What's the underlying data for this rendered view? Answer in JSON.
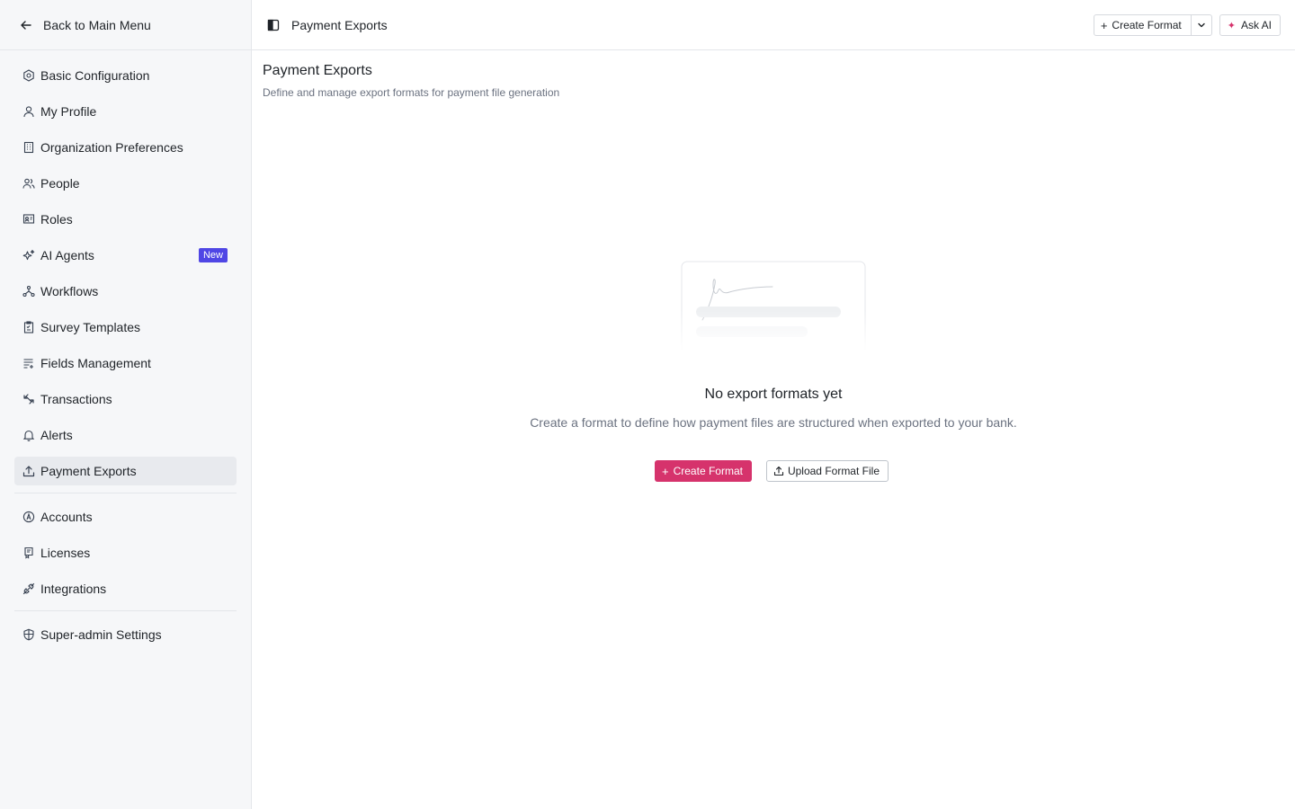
{
  "sidebar": {
    "back_label": "Back to Main Menu",
    "items": [
      {
        "label": "Basic Configuration",
        "icon": "gear-icon"
      },
      {
        "label": "My Profile",
        "icon": "user-icon"
      },
      {
        "label": "Organization Preferences",
        "icon": "building-icon"
      },
      {
        "label": "People",
        "icon": "users-icon"
      },
      {
        "label": "Roles",
        "icon": "id-card-icon"
      },
      {
        "label": "AI Agents",
        "icon": "sparkles-icon",
        "badge": "New"
      },
      {
        "label": "Workflows",
        "icon": "workflow-icon"
      },
      {
        "label": "Survey Templates",
        "icon": "clipboard-icon"
      },
      {
        "label": "Fields Management",
        "icon": "list-icon"
      },
      {
        "label": "Transactions",
        "icon": "transfer-icon"
      },
      {
        "label": "Alerts",
        "icon": "bell-icon"
      },
      {
        "label": "Payment Exports",
        "icon": "upload-icon",
        "active": true
      }
    ],
    "group2": [
      {
        "label": "Accounts",
        "icon": "circle-a-icon"
      },
      {
        "label": "Licenses",
        "icon": "license-icon"
      },
      {
        "label": "Integrations",
        "icon": "plug-icon"
      }
    ],
    "group3": [
      {
        "label": "Super-admin Settings",
        "icon": "shield-icon"
      }
    ]
  },
  "header": {
    "breadcrumb": "Payment Exports",
    "create_format_label": "Create Format",
    "ask_ai_label": "Ask AI"
  },
  "main": {
    "title": "Payment Exports",
    "subtitle": "Define and manage export formats for payment file generation",
    "empty_title": "No export formats yet",
    "empty_description": "Create a format to define how payment files are structured when exported to your bank.",
    "create_button": "Create Format",
    "upload_button": "Upload Format File"
  },
  "colors": {
    "accent": "#d6336c",
    "badge": "#4f46e5"
  }
}
